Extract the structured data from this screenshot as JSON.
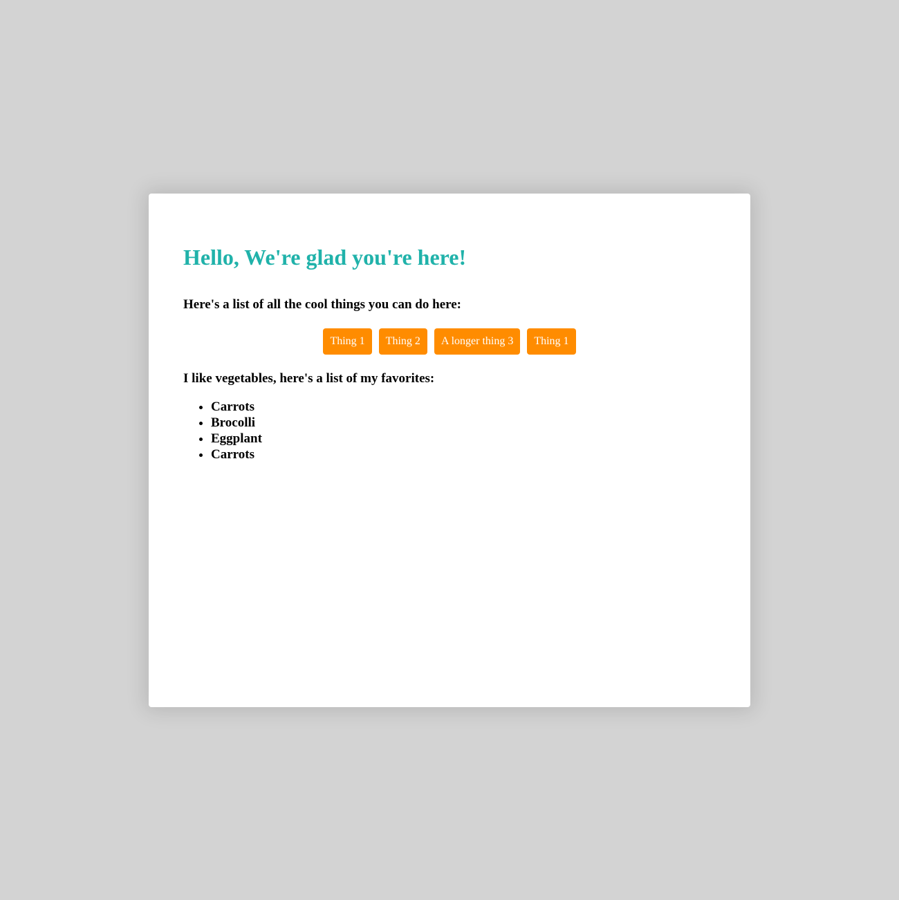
{
  "card": {
    "title": "Hello, We're glad you're here!",
    "intro": "Here's a list of all the cool things you can do here:",
    "things": [
      "Thing 1",
      "Thing 2",
      "A longer thing 3",
      "Thing 1"
    ],
    "veg_intro": "I like vegetables, here's a list of my favorites:",
    "vegetables": [
      "Carrots",
      "Brocolli",
      "Eggplant",
      "Carrots"
    ]
  },
  "colors": {
    "background": "#d3d3d3",
    "card": "#ffffff",
    "title": "#20b2aa",
    "button": "#ff8c00",
    "button_text": "#ffffff"
  }
}
